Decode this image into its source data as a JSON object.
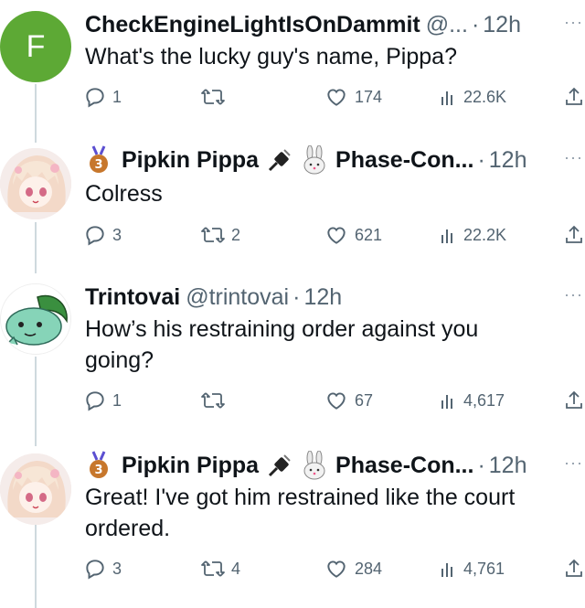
{
  "tweets": [
    {
      "avatar_letter": "F",
      "name": "CheckEngineLightIsOnDammit",
      "handle": "@...",
      "time": "12h",
      "text": [
        "What's the lucky guy's name, Pippa?"
      ],
      "replies": "1",
      "retweets": "",
      "likes": "174",
      "views": "22.6K"
    },
    {
      "name": "Pipkin Pippa",
      "handle": "Phase-Con...",
      "time": "12h",
      "text": [
        "Colress"
      ],
      "replies": "3",
      "retweets": "2",
      "likes": "621",
      "views": "22.2K"
    },
    {
      "name": "Trintovai",
      "handle": "@trintovai",
      "time": "12h",
      "text": [
        "How’s his restraining order against you",
        "going?"
      ],
      "replies": "1",
      "retweets": "",
      "likes": "67",
      "views": "4,617"
    },
    {
      "name": "Pipkin Pippa",
      "handle": "Phase-Con...",
      "time": "12h",
      "text": [
        "Great! I've got him restrained like the court",
        "ordered."
      ],
      "replies": "3",
      "retweets": "4",
      "likes": "284",
      "views": "4,761"
    }
  ],
  "colors": {
    "green_avatar": "#5da935",
    "muted": "#536471",
    "line": "#cfd9de"
  },
  "icons": [
    "reply-icon",
    "retweet-icon",
    "like-icon",
    "views-icon",
    "share-icon",
    "more-icon",
    "bronze-medal-icon",
    "plug-icon",
    "rabbit-icon"
  ]
}
